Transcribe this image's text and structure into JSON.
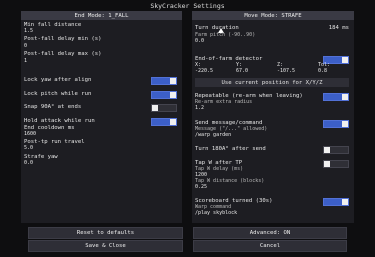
{
  "window": {
    "title": "SkyCracker Settings"
  },
  "left": {
    "header": "End Mode: 1_FALL",
    "fields": [
      {
        "label": "Min fall distance",
        "value": "1.5"
      },
      {
        "label": "Post-fall delay min (s)",
        "value": "0"
      },
      {
        "label": "Post-fall delay max (s)",
        "value": "1"
      }
    ],
    "toggles": [
      {
        "label": "Lock yaw after align",
        "state": true
      },
      {
        "label": "Lock pitch while run",
        "state": true
      },
      {
        "label": "Snap 90A° at ends",
        "state": false
      },
      {
        "label": "Hold attack while run",
        "state": true
      }
    ],
    "end_cooldown": {
      "label": "End cooldown ms",
      "value": "1600"
    },
    "post_tp": {
      "label": "Post-tp run travel",
      "value": "5.0"
    },
    "strafe": {
      "label": "Strafe yaw",
      "value": "0.0"
    }
  },
  "right": {
    "header": "Move Mode: STRAFE",
    "turn_duration": {
      "label": "Turn duration",
      "ms": "184 ms",
      "sub": "Farm pitch (-90..90)",
      "value": "0.0"
    },
    "end_detector": {
      "label": "End-of-farm detector",
      "x_label": "X:",
      "x": "-220.5",
      "y_label": "Y:",
      "y": "67.0",
      "z_label": "Z:",
      "z": "-107.5",
      "tol_label": "Tol:",
      "tol": "0.8",
      "use_pos": "Use current position for X/Y/Z"
    },
    "repeatable": {
      "label": "Repeatable (re-arm when leaving)",
      "state": true,
      "sub": "Re-arm extra radius",
      "value": "1.2"
    },
    "send_message": {
      "label": "Send message/command",
      "state": true,
      "sub": "Message (\"/...\" allowed)",
      "value": "/warp garden"
    },
    "turn_180": {
      "label": "Turn 180A° after send",
      "state": false
    },
    "tap_w": {
      "label": "Tap W after TP",
      "state": false,
      "delay_label": "Tap W delay (ms)",
      "delay": "1200",
      "dist_label": "Tap W distance (blocks)",
      "dist": "0.25"
    },
    "scoreboard": {
      "label": "Scoreboard turned (30s)",
      "state": true,
      "sub": "Warp command",
      "value": "/play skyblock"
    }
  },
  "buttons": {
    "reset": "Reset to defaults",
    "advanced": "Advanced: ON",
    "save": "Save & Close",
    "cancel": "Cancel"
  },
  "colors": {
    "accent": "#3c5fc8",
    "panel": "#1d1d22",
    "background": "#0e0e10"
  }
}
